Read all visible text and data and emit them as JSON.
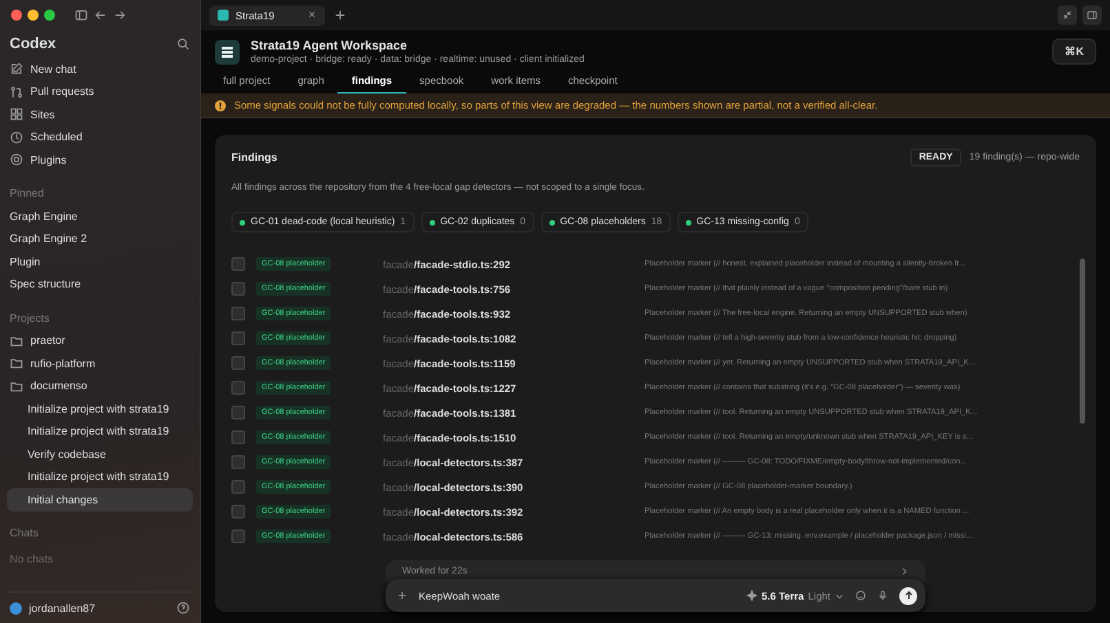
{
  "sidebar": {
    "app_name": "Codex",
    "nav": [
      {
        "label": "New chat",
        "kind": "new"
      },
      {
        "label": "Pull requests",
        "kind": "pr"
      },
      {
        "label": "Sites",
        "kind": "sites"
      },
      {
        "label": "Scheduled",
        "kind": "clock"
      },
      {
        "label": "Plugins",
        "kind": "plugin"
      }
    ],
    "pinned_heading": "Pinned",
    "pinned": [
      "Graph Engine",
      "Graph Engine 2",
      "Plugin",
      "Spec structure"
    ],
    "projects_heading": "Projects",
    "projects": [
      {
        "label": "praetor"
      },
      {
        "label": "rufio-platform"
      },
      {
        "label": "documenso",
        "children": [
          {
            "label": "Initialize project with strata19",
            "selected": false
          },
          {
            "label": "Initialize project with strata19",
            "selected": false
          },
          {
            "label": "Verify codebase",
            "selected": false
          },
          {
            "label": "Initialize project with strata19",
            "selected": false
          },
          {
            "label": "Initial changes",
            "selected": true
          }
        ]
      }
    ],
    "chats_heading": "Chats",
    "chats_empty": "No chats",
    "user": "jordanallen87"
  },
  "browser_tab": {
    "title": "Strata19"
  },
  "header": {
    "title": "Strata19 Agent Workspace",
    "subtitle": "demo-project · bridge: ready · data: bridge · realtime: unused · client initialized",
    "shortcut": "⌘K"
  },
  "tabs": [
    {
      "label": "full project",
      "selected": false
    },
    {
      "label": "graph",
      "selected": false
    },
    {
      "label": "findings",
      "selected": true
    },
    {
      "label": "specbook",
      "selected": false
    },
    {
      "label": "work items",
      "selected": false
    },
    {
      "label": "checkpoint",
      "selected": false
    }
  ],
  "warning": "Some signals could not be fully computed locally, so parts of this view are degraded — the numbers shown are partial, not a verified all-clear.",
  "findings": {
    "title": "Findings",
    "status": "READY",
    "summary": "19 finding(s) — repo-wide",
    "description": "All findings across the repository from the 4 free-local gap detectors — not scoped to a single focus.",
    "detectors": [
      {
        "label": "GC-01 dead-code (local heuristic)",
        "count": "1"
      },
      {
        "label": "GC-02 duplicates",
        "count": "0"
      },
      {
        "label": "GC-08 placeholders",
        "count": "18"
      },
      {
        "label": "GC-13 missing-config",
        "count": "0"
      }
    ],
    "rows": [
      {
        "checked": false,
        "tag": "GC-08 placeholder",
        "dir": "facade",
        "file": "/facade-stdio.ts:292",
        "detail": "Placeholder marker (// honest, explained placeholder instead of mounting a silently-broken fr..."
      },
      {
        "checked": false,
        "tag": "GC-08 placeholder",
        "dir": "facade",
        "file": "/facade-tools.ts:756",
        "detail": "Placeholder marker (// that plainly instead of a vague \"composition pending\"/bare stub in)"
      },
      {
        "checked": false,
        "tag": "GC-08 placeholder",
        "dir": "facade",
        "file": "/facade-tools.ts:932",
        "detail": "Placeholder marker (// The free-local engine. Returning an empty UNSUPPORTED stub when)"
      },
      {
        "checked": false,
        "tag": "GC-08 placeholder",
        "dir": "facade",
        "file": "/facade-tools.ts:1082",
        "detail": "Placeholder marker (// tell a high-severity stub from a low-confidence heuristic hit; dropping)"
      },
      {
        "checked": false,
        "tag": "GC-08 placeholder",
        "dir": "facade",
        "file": "/facade-tools.ts:1159",
        "detail": "Placeholder marker (// yet. Returning an empty UNSUPPORTED stub when STRATA19_API_K..."
      },
      {
        "checked": false,
        "tag": "GC-08 placeholder",
        "dir": "facade",
        "file": "/facade-tools.ts:1227",
        "detail": "Placeholder marker (// contains that substring (it's e.g. \"GC-08 placeholder\") — severity was)"
      },
      {
        "checked": false,
        "tag": "GC-08 placeholder",
        "dir": "facade",
        "file": "/facade-tools.ts:1381",
        "detail": "Placeholder marker (// tool. Returning an empty UNSUPPORTED stub when STRATA19_API_K..."
      },
      {
        "checked": false,
        "tag": "GC-08 placeholder",
        "dir": "facade",
        "file": "/facade-tools.ts:1510",
        "detail": "Placeholder marker (// tool. Returning an empty/unknown stub when STRATA19_API_KEY is s..."
      },
      {
        "checked": false,
        "tag": "GC-08 placeholder",
        "dir": "facade",
        "file": "/local-detectors.ts:387",
        "detail": "Placeholder marker (// ——— GC-08: TODO/FIXME/empty-body/throw-not-implemented/con..."
      },
      {
        "checked": false,
        "tag": "GC-08 placeholder",
        "dir": "facade",
        "file": "/local-detectors.ts:390",
        "detail": "Placeholder marker (// GC-08 placeholder-marker boundary.)"
      },
      {
        "checked": false,
        "tag": "GC-08 placeholder",
        "dir": "facade",
        "file": "/local-detectors.ts:392",
        "detail": "Placeholder marker (// An empty body is a real placeholder only when it is a NAMED function ..."
      },
      {
        "checked": false,
        "tag": "GC-08 placeholder",
        "dir": "facade",
        "file": "/local-detectors.ts:586",
        "detail": "Placeholder marker (// ——— GC-13: missing .env.example / placeholder package.json / missi..."
      }
    ]
  },
  "composer": {
    "activity": "Worked for 22s",
    "value": "KeepWoah woate",
    "model": "5.6 Terra",
    "effort": "Light"
  }
}
